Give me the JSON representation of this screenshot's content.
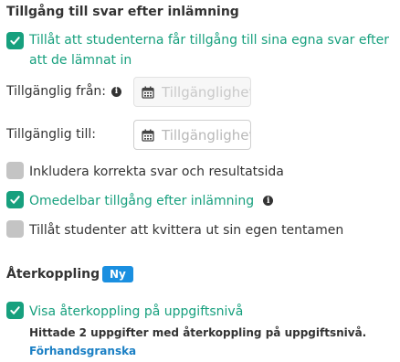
{
  "access": {
    "title": "Tillgång till svar efter inlämning",
    "allow_access": {
      "label": "Tillåt att studenterna får tillgång till sina egna svar efter att de lämnat in",
      "checked": true
    },
    "available_from": {
      "label": "Tillgänglig från:",
      "placeholder": "Tillgänglighetsdatum",
      "disabled": true
    },
    "available_to": {
      "label": "Tillgänglig till:",
      "placeholder": "Tillgänglighetsdatum",
      "disabled": false
    },
    "include_correct": {
      "label": "Inkludera korrekta svar och resultatsida",
      "checked": false
    },
    "immediate_access": {
      "label": "Omedelbar tillgång efter inlämning",
      "checked": true
    },
    "allow_acknowledge": {
      "label": "Tillåt studenter att kvittera ut sin egen tentamen",
      "checked": false
    }
  },
  "feedback": {
    "title": "Återkoppling",
    "badge": "Ny",
    "show_task_feedback": {
      "label": "Visa återkoppling på uppgiftsnivå",
      "checked": true
    },
    "found_text": "Hittade 2 uppgifter med återkoppling på uppgiftsnivå.",
    "preview_link": "Förhandsgranska"
  },
  "colors": {
    "accent": "#17a07e",
    "badge": "#1a8fe0",
    "link": "#1a7fc4",
    "unchecked": "#c4c4c4"
  }
}
